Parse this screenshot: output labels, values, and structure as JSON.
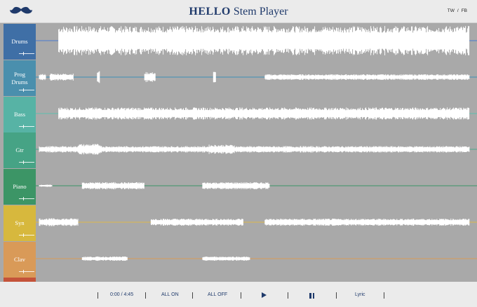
{
  "header": {
    "brand": "HELLO",
    "subtitle": "Stem Player",
    "social_tw": "TW",
    "social_sep": "/",
    "social_fb": "FB"
  },
  "tracks": [
    {
      "label": "Drums",
      "color": "#3f6fa6",
      "line": "#4a7bd0"
    },
    {
      "label": "Prog Drums",
      "color": "#4a8fad",
      "line": "#3d8fb8"
    },
    {
      "label": "Bass",
      "color": "#57b3a5",
      "line": "#5cc0ae"
    },
    {
      "label": "Gtr",
      "color": "#46a385",
      "line": "#4aa88a"
    },
    {
      "label": "Piano",
      "color": "#3c9566",
      "line": "#3c9566"
    },
    {
      "label": "Syn",
      "color": "#d7b83d",
      "line": "#e0b94a"
    },
    {
      "label": "Clav",
      "color": "#d99a58",
      "line": "#d99a58"
    }
  ],
  "controls": {
    "time": "0:00 / 4:45",
    "all_on": "ALL ON",
    "all_off": "ALL OFF",
    "lyric": "Lyric",
    "play_icon": "play-icon",
    "pause_icon": "pause-icon"
  },
  "waveforms": [
    [
      [
        0.045,
        1.0,
        0.82
      ]
    ],
    [
      [
        0.0,
        0.015,
        0.18
      ],
      [
        0.025,
        0.08,
        0.2
      ],
      [
        0.135,
        0.14,
        0.35
      ],
      [
        0.245,
        0.27,
        0.28
      ],
      [
        0.405,
        0.41,
        0.32
      ],
      [
        0.525,
        1.0,
        0.16
      ]
    ],
    [
      [
        0.045,
        1.0,
        0.34
      ]
    ],
    [
      [
        0.0,
        0.09,
        0.18
      ],
      [
        0.09,
        0.145,
        0.3
      ],
      [
        0.145,
        0.395,
        0.18
      ],
      [
        0.395,
        0.455,
        0.26
      ],
      [
        0.455,
        1.0,
        0.18
      ]
    ],
    [
      [
        0.0,
        0.03,
        0.06
      ],
      [
        0.1,
        0.245,
        0.2
      ],
      [
        0.38,
        0.535,
        0.2
      ]
    ],
    [
      [
        0.0,
        0.09,
        0.22
      ],
      [
        0.26,
        0.475,
        0.2
      ],
      [
        0.525,
        1.0,
        0.2
      ]
    ],
    [
      [
        0.1,
        0.205,
        0.12
      ],
      [
        0.38,
        0.49,
        0.12
      ]
    ]
  ]
}
